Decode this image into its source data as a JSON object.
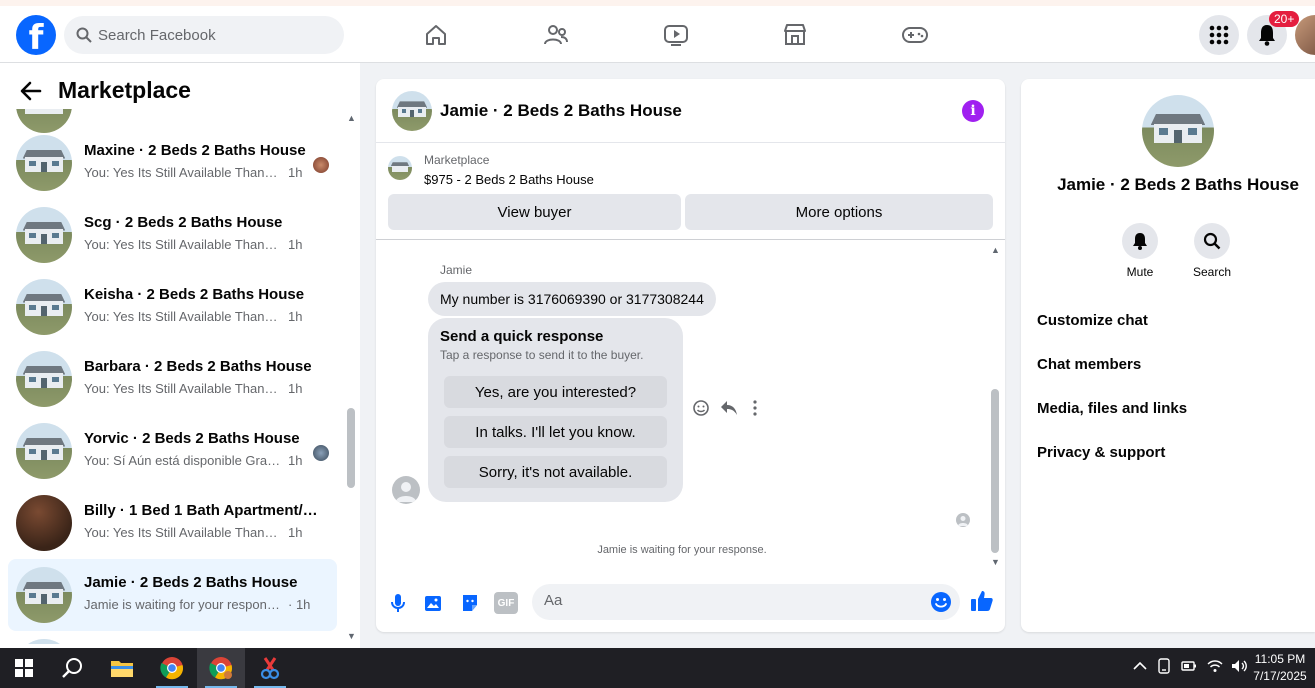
{
  "topnav": {
    "logo": "f",
    "search_placeholder": "Search Facebook",
    "notifications_badge": "20+"
  },
  "sidebar": {
    "title": "Marketplace",
    "conversations": [
      {
        "name": "Maxine · 2 Beds 2 Baths House",
        "snippet": "You: Yes Its Still Available Thanks...",
        "time": "1h"
      },
      {
        "name": "Scg · 2 Beds 2 Baths House",
        "snippet": "You: Yes Its Still Available Thanks fo...",
        "time": "1h"
      },
      {
        "name": "Keisha · 2 Beds 2 Baths House",
        "snippet": "You: Yes Its Still Available Thanks fo...",
        "time": "1h"
      },
      {
        "name": "Barbara · 2 Beds 2 Baths House",
        "snippet": "You: Yes Its Still Available Thanks fo...",
        "time": "1h"
      },
      {
        "name": "Yorvic · 2 Beds 2 Baths House",
        "snippet": "You: Sí Aún está disponible Grac...",
        "time": "1h"
      },
      {
        "name": "Billy · 1 Bed 1 Bath Apartment/co...",
        "snippet": "You: Yes Its Still Available Thanks fo...",
        "time": "1h"
      },
      {
        "name": "Jamie · 2 Beds 2 Baths House",
        "snippet": "Jamie is waiting for your response.",
        "time": "· 1h"
      }
    ]
  },
  "chat": {
    "title": "Jamie · 2 Beds 2 Baths House",
    "listing_source": "Marketplace",
    "listing_price": "$975 - 2 Beds 2 Baths House",
    "view_buyer": "View buyer",
    "more_options": "More options",
    "sender": "Jamie",
    "message": "My number is 3176069390 or 3177308244",
    "quick_title": "Send a quick response",
    "quick_subtitle": "Tap a response to send it to the buyer.",
    "quick_responses": [
      "Yes, are you interested?",
      "In talks. I'll let you know.",
      "Sorry, it's not available."
    ],
    "waiting_note": "Jamie is waiting for your response.",
    "composer_placeholder": "Aa",
    "gif_label": "GIF"
  },
  "details": {
    "name": "Jamie · 2 Beds 2 Baths House",
    "mute": "Mute",
    "search": "Search",
    "sections": [
      "Customize chat",
      "Chat members",
      "Media, files and links",
      "Privacy & support"
    ]
  },
  "taskbar": {
    "time": "11:05 PM",
    "date": "7/17/2025"
  },
  "colors": {
    "brand_blue": "#0866ff",
    "info_purple": "#a020f0",
    "badge_red": "#e41e3f",
    "active_row": "#ebf5ff"
  }
}
